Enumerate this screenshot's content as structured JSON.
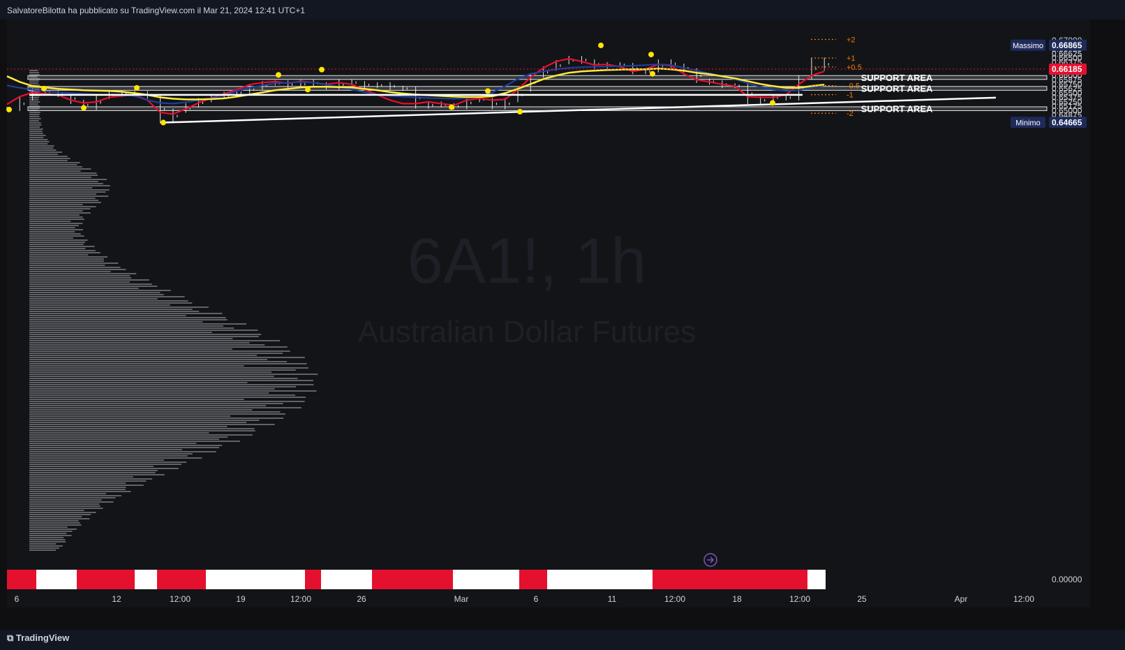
{
  "header": {
    "publisher_line": "SalvatoreBilotta ha pubblicato su TradingView.com il Mar 21, 2024 12:41 UTC+1"
  },
  "brand": {
    "name": "TradingView"
  },
  "watermark": {
    "symbol": "6A1!, 1h",
    "name": "Australian Dollar Futures"
  },
  "chart_data": {
    "type": "line",
    "title": "",
    "y_axis": {
      "ticks": [
        "0.67000",
        "0.66750",
        "0.66625",
        "0.66500",
        "0.66375",
        "0.66250",
        "0.66125",
        "0.66000",
        "0.65875",
        "0.65750",
        "0.65625",
        "0.65500",
        "0.65375",
        "0.65250",
        "0.65125",
        "0.65000",
        "0.64875",
        "0.64750",
        "0.64625"
      ],
      "ylim": [
        0.64625,
        0.67
      ]
    },
    "volume_tick": "0.00000",
    "x_axis": {
      "ticks": [
        "6",
        "12",
        "12:00",
        "19",
        "12:00",
        "26",
        "Mar",
        "6",
        "11",
        "12:00",
        "18",
        "12:00",
        "25",
        "Apr",
        "12:00"
      ]
    },
    "price_labels": {
      "high": {
        "label": "Massimo",
        "value": "0.66865",
        "v": 0.66865
      },
      "last": {
        "value": "0.66185",
        "v": 0.66185
      },
      "low": {
        "label": "Minimo",
        "value": "0.64665",
        "v": 0.64665
      }
    },
    "support_zones": [
      {
        "label": "SUPPORT AREA",
        "from": 0.6589,
        "to": 0.66
      },
      {
        "label": "SUPPORT AREA",
        "from": 0.6558,
        "to": 0.6569
      },
      {
        "label": "SUPPORT AREA",
        "from": 0.65,
        "to": 0.6511
      }
    ],
    "levels": [
      {
        "label": "+2",
        "v": 0.6703
      },
      {
        "label": "+1",
        "v": 0.665
      },
      {
        "label": "+0.5",
        "v": 0.66245
      },
      {
        "label": "-0.5",
        "v": 0.65715
      },
      {
        "label": "-1",
        "v": 0.65455
      },
      {
        "label": "-2",
        "v": 0.64925
      }
    ],
    "horizontal_line": 0.6545,
    "trendline": {
      "from": {
        "x": 5,
        "y": 0.6466
      },
      "to": {
        "x": 44,
        "y": 0.6537
      }
    },
    "series": [
      {
        "values": [
          0.6505,
          0.6535,
          0.6558,
          0.655,
          0.6545,
          0.6525,
          0.6508,
          0.654,
          0.655,
          0.6545,
          0.655,
          0.654,
          0.647,
          0.65,
          0.6515,
          0.653,
          0.654,
          0.6548,
          0.6555,
          0.6565,
          0.6578,
          0.658,
          0.657,
          0.6582,
          0.6575,
          0.6566,
          0.6583,
          0.6578,
          0.657,
          0.6575,
          0.6565,
          0.6562,
          0.6512,
          0.652,
          0.6515,
          0.651,
          0.6535,
          0.653,
          0.651,
          0.653,
          0.656,
          0.66,
          0.662,
          0.6638,
          0.665,
          0.664,
          0.6625,
          0.6632,
          0.663,
          0.661,
          0.6615,
          0.664,
          0.6628,
          0.6615,
          0.6585,
          0.658,
          0.657,
          0.6572,
          0.6525,
          0.6535,
          0.654,
          0.6535,
          0.6595,
          0.6645,
          0.662
        ]
      },
      {
        "values": [
          0.6518,
          0.654,
          0.6552,
          0.6548,
          0.6545,
          0.653,
          0.6522,
          0.6525,
          0.6538,
          0.6542,
          0.6545,
          0.653,
          0.6495,
          0.649,
          0.6505,
          0.6522,
          0.6536,
          0.6548,
          0.656,
          0.6574,
          0.658,
          0.6583,
          0.6578,
          0.6584,
          0.658,
          0.6575,
          0.658,
          0.6575,
          0.656,
          0.6545,
          0.653,
          0.652,
          0.652,
          0.6525,
          0.652,
          0.6515,
          0.653,
          0.6535,
          0.653,
          0.6532,
          0.656,
          0.6595,
          0.6622,
          0.664,
          0.6648,
          0.664,
          0.663,
          0.6632,
          0.6625,
          0.6612,
          0.6618,
          0.6632,
          0.6628,
          0.6605,
          0.6588,
          0.6582,
          0.6575,
          0.657,
          0.654,
          0.6538,
          0.6538,
          0.6545,
          0.6575,
          0.66,
          0.6612
        ]
      },
      {
        "values": [
          0.6572,
          0.6565,
          0.656,
          0.6555,
          0.6552,
          0.655,
          0.6548,
          0.6546,
          0.6545,
          0.6544,
          0.6542,
          0.653,
          0.6522,
          0.652,
          0.6524,
          0.653,
          0.6535,
          0.6544,
          0.6556,
          0.6565,
          0.6572,
          0.6578,
          0.658,
          0.6582,
          0.658,
          0.6574,
          0.6568,
          0.656,
          0.6553,
          0.6545,
          0.6542,
          0.654,
          0.6538,
          0.6536,
          0.6535,
          0.6534,
          0.6536,
          0.654,
          0.6552,
          0.657,
          0.659,
          0.6605,
          0.6612,
          0.6618,
          0.6622,
          0.6624,
          0.6625,
          0.6626,
          0.6627,
          0.6628,
          0.663,
          0.6632,
          0.663,
          0.6622,
          0.6614,
          0.6606,
          0.6598,
          0.659,
          0.6578,
          0.6568,
          0.656,
          0.6556,
          0.6558,
          0.6566,
          0.6572
        ]
      },
      {
        "values": [
          0.6598,
          0.6582,
          0.657,
          0.6566,
          0.6562,
          0.656,
          0.6558,
          0.6557,
          0.6556,
          0.6554,
          0.655,
          0.6545,
          0.6538,
          0.6534,
          0.6532,
          0.6532,
          0.6533,
          0.6535,
          0.654,
          0.6546,
          0.6552,
          0.6558,
          0.6562,
          0.6566,
          0.6568,
          0.6568,
          0.6567,
          0.6566,
          0.6562,
          0.6558,
          0.6553,
          0.6549,
          0.6546,
          0.6544,
          0.6542,
          0.654,
          0.6539,
          0.6539,
          0.6541,
          0.655,
          0.6562,
          0.6576,
          0.659,
          0.66,
          0.6608,
          0.6612,
          0.6614,
          0.6616,
          0.6617,
          0.6618,
          0.6618,
          0.662,
          0.6618,
          0.6614,
          0.6608,
          0.6604,
          0.6598,
          0.6592,
          0.6584,
          0.6576,
          0.657,
          0.6565,
          0.6565,
          0.657,
          0.6574
        ]
      }
    ],
    "markers": [
      0.6503,
      0.6563,
      0.6508,
      0.6565,
      0.6466,
      0.6602,
      0.656,
      0.6617,
      0.6556,
      0.651,
      0.6497,
      0.6686,
      0.666,
      0.6605,
      0.6522
    ],
    "volume_blocks": [
      "red",
      "white",
      "red",
      "white",
      "red",
      "white",
      "red",
      "white",
      "red",
      "white",
      "red",
      "white",
      "red",
      "white"
    ]
  }
}
